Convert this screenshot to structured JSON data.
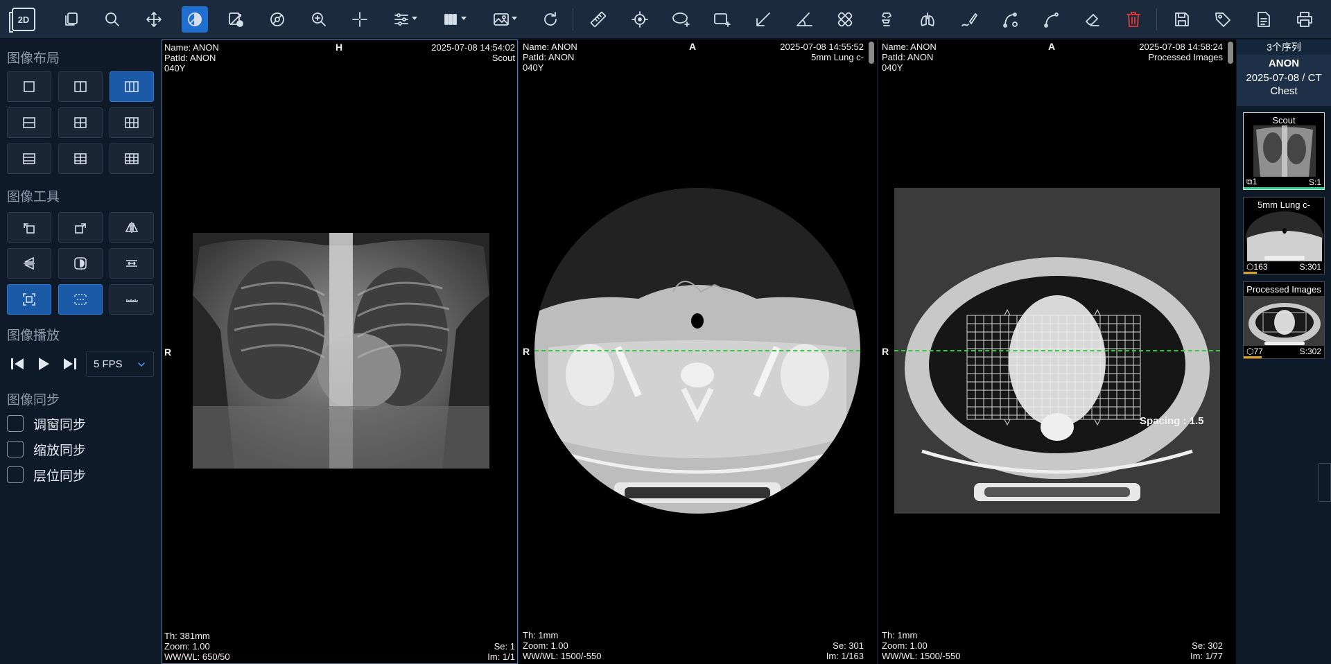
{
  "toolbar": {
    "logo": "2D",
    "tools": [
      "series-stack",
      "zoom-search",
      "pan-move",
      "window-level",
      "reset-view",
      "rotate-3d",
      "magnifier",
      "crosshair",
      "adjust-settings",
      "layout-grid",
      "image-display",
      "refresh-rotate",
      "ruler",
      "point-target",
      "ellipse-roi",
      "rectangle-roi",
      "arrow",
      "angle",
      "bandage",
      "spine-label",
      "lung-shape",
      "freehand-pen",
      "curve-tool",
      "cobb-angle",
      "eraser",
      "delete-trash",
      "save",
      "tag-label",
      "report-document",
      "print"
    ]
  },
  "left": {
    "layout_title": "图像布局",
    "tools_title": "图像工具",
    "playback_title": "图像播放",
    "fps": "5 FPS",
    "sync_title": "图像同步",
    "sync": [
      "调窗同步",
      "缩放同步",
      "层位同步"
    ]
  },
  "viewports": [
    {
      "name": "Name: ANON",
      "patid": "PatId: ANON",
      "age": "040Y",
      "orient_top": "H",
      "orient_left": "R",
      "datetime": "2025-07-08 14:54:02",
      "series_label": "Scout",
      "th": "Th: 381mm",
      "zoom": "Zoom: 1.00",
      "wwwl": "WW/WL: 650/50",
      "se": "Se: 1",
      "im": "Im: 1/1"
    },
    {
      "name": "Name: ANON",
      "patid": "PatId: ANON",
      "age": "040Y",
      "orient_top": "A",
      "orient_left": "R",
      "datetime": "2025-07-08 14:55:52",
      "series_label": "5mm Lung c-",
      "th": "Th: 1mm",
      "zoom": "Zoom: 1.00",
      "wwwl": "WW/WL: 1500/-550",
      "se": "Se: 301",
      "im": "Im: 1/163"
    },
    {
      "name": "Name: ANON",
      "patid": "PatId: ANON",
      "age": "040Y",
      "orient_top": "A",
      "orient_left": "R",
      "datetime": "2025-07-08 14:58:24",
      "series_label": "Processed Images",
      "th": "Th: 1mm",
      "zoom": "Zoom: 1.00",
      "wwwl": "WW/WL: 1500/-550",
      "se": "Se: 302",
      "im": "Im: 1/77",
      "spacing": "Spacing : 1.5"
    }
  ],
  "right": {
    "count": "3个序列",
    "patient": "ANON",
    "study": "2025-07-08 / CT",
    "body_part": "Chest",
    "thumbs": [
      {
        "title": "Scout",
        "count": "1",
        "s": "S:1",
        "bar_color": "#2fcf8a"
      },
      {
        "title": "5mm Lung c-",
        "count": "163",
        "s": "S:301",
        "bar_color": "#e0a020"
      },
      {
        "title": "Processed Images",
        "count": "77",
        "s": "S:302",
        "bar_color": "#e0a020"
      }
    ]
  },
  "colors": {
    "accent": "#1f6fd0",
    "panel": "#0f1a28",
    "toolbar": "#1b2a3d",
    "crosshair": "#2fcf3a",
    "delete": "#e23b3b"
  }
}
